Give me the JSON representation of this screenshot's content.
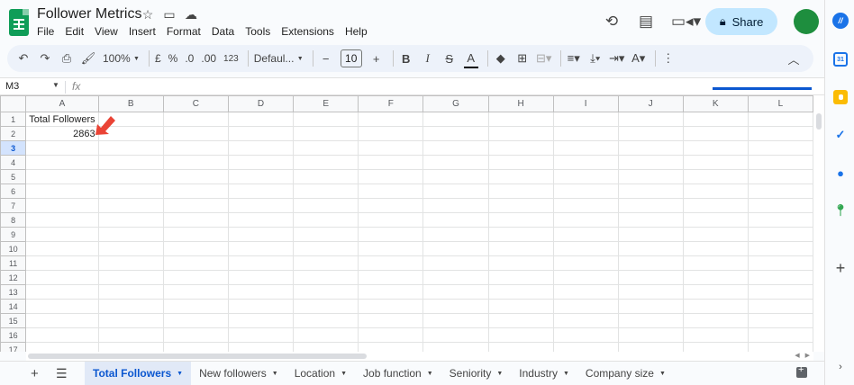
{
  "header": {
    "title": "Follower Metrics",
    "menu": [
      "File",
      "Edit",
      "View",
      "Insert",
      "Format",
      "Data",
      "Tools",
      "Extensions",
      "Help"
    ],
    "share_label": "Share"
  },
  "toolbar": {
    "zoom": "100%",
    "currency": "£",
    "percent": "%",
    "decrease_decimal": ".0",
    "increase_decimal": ".00",
    "number_format": "123",
    "font": "Defaul...",
    "font_size": "10"
  },
  "formula_bar": {
    "cell_ref": "M3",
    "fx": "fx"
  },
  "grid": {
    "columns": [
      "A",
      "B",
      "C",
      "D",
      "E",
      "F",
      "G",
      "H",
      "I",
      "J",
      "K",
      "L"
    ],
    "rows": [
      "1",
      "2",
      "3",
      "4",
      "5",
      "6",
      "7",
      "8",
      "9",
      "10",
      "11",
      "12",
      "13",
      "14",
      "15",
      "16",
      "17"
    ],
    "a1": "Total Followers",
    "a2": "2863"
  },
  "sheets": [
    "Total Followers",
    "New followers",
    "Location",
    "Job function",
    "Seniority",
    "Industry",
    "Company size"
  ],
  "side_panel": {
    "calendar_day": "31"
  },
  "colors": {
    "accent": "#0b57d0",
    "share_bg": "#c2e7ff",
    "arrow": "#ea4335",
    "sheets_green": "#0f9d58"
  }
}
